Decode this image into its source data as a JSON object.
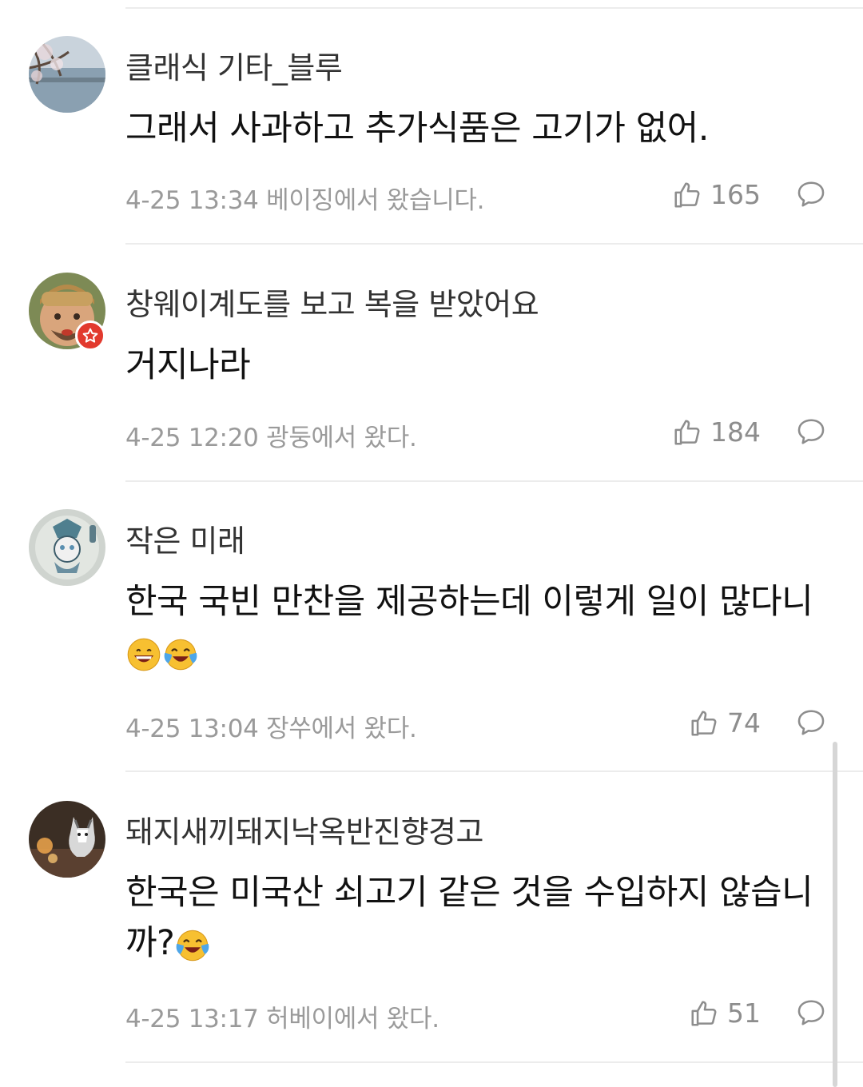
{
  "comments": [
    {
      "username": "클래식 기타_블루",
      "text": "그래서 사과하고 추가식품은 고기가 없어.",
      "timestamp": "4-25 13:34",
      "location": "베이징에서 왔습니다.",
      "likes": "165",
      "avatar": "lake-with-blossoms"
    },
    {
      "username": "창웨이계도를 보고 복을 받았어요",
      "text": "거지나라",
      "timestamp": "4-25 12:20",
      "location": "광둥에서 왔다.",
      "likes": "184",
      "avatar": "person-with-beard",
      "badge": "star-badge"
    },
    {
      "username": "작은 미래",
      "text": "한국 국빈 만찬을 제공하는데 이렇게 일이 많다니",
      "emojis": [
        "grinning-face",
        "laughing-crying-face"
      ],
      "timestamp": "4-25 13:04",
      "location": "장쑤에서 왔다.",
      "likes": "74",
      "avatar": "illustrated-character"
    },
    {
      "username": "돼지새끼돼지낙옥반진향경고",
      "text": "한국은 미국산 쇠고기 같은 것을 수입하지 않습니까?",
      "emojis": [
        "laughing-crying-face"
      ],
      "timestamp": "4-25 13:17",
      "location": "허베이에서 왔다.",
      "likes": "51",
      "avatar": "husky-dog"
    }
  ],
  "colors": {
    "meta_text": "#9a9a9a",
    "divider": "#ececec",
    "badge": "#e23a2e"
  }
}
